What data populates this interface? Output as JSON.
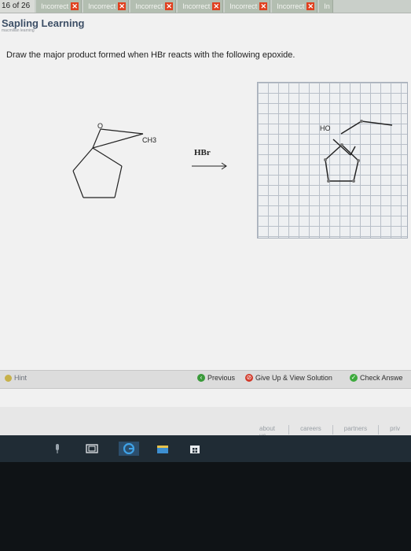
{
  "tabbar": {
    "counter": "16 of 26",
    "tabs": [
      {
        "label": "Incorrect"
      },
      {
        "label": "Incorrect"
      },
      {
        "label": "Incorrect"
      },
      {
        "label": "Incorrect"
      },
      {
        "label": "Incorrect"
      },
      {
        "label": "Incorrect"
      },
      {
        "label": "In"
      }
    ]
  },
  "logo": {
    "title": "Sapling Learning",
    "subtitle": "macmillan learning"
  },
  "question": {
    "text": "Draw the major product formed when HBr reacts with the following epoxide."
  },
  "reaction": {
    "oxygen_label": "O",
    "methyl_label": "CH3",
    "reagent_label": "HBr"
  },
  "answer_canvas": {
    "label": "HO"
  },
  "actions": {
    "hint": "Hint",
    "previous": "Previous",
    "give_up": "Give Up & View Solution",
    "check": "Check Answe"
  },
  "footer": {
    "links": [
      "about us",
      "careers",
      "partners",
      "priv"
    ]
  },
  "colors": {
    "incorrect_x": "#e0401f",
    "previous_icon": "#3a9a3a",
    "giveup_icon": "#d23a2a",
    "check_icon": "#3eaa3e",
    "taskbar": "#202c35"
  }
}
